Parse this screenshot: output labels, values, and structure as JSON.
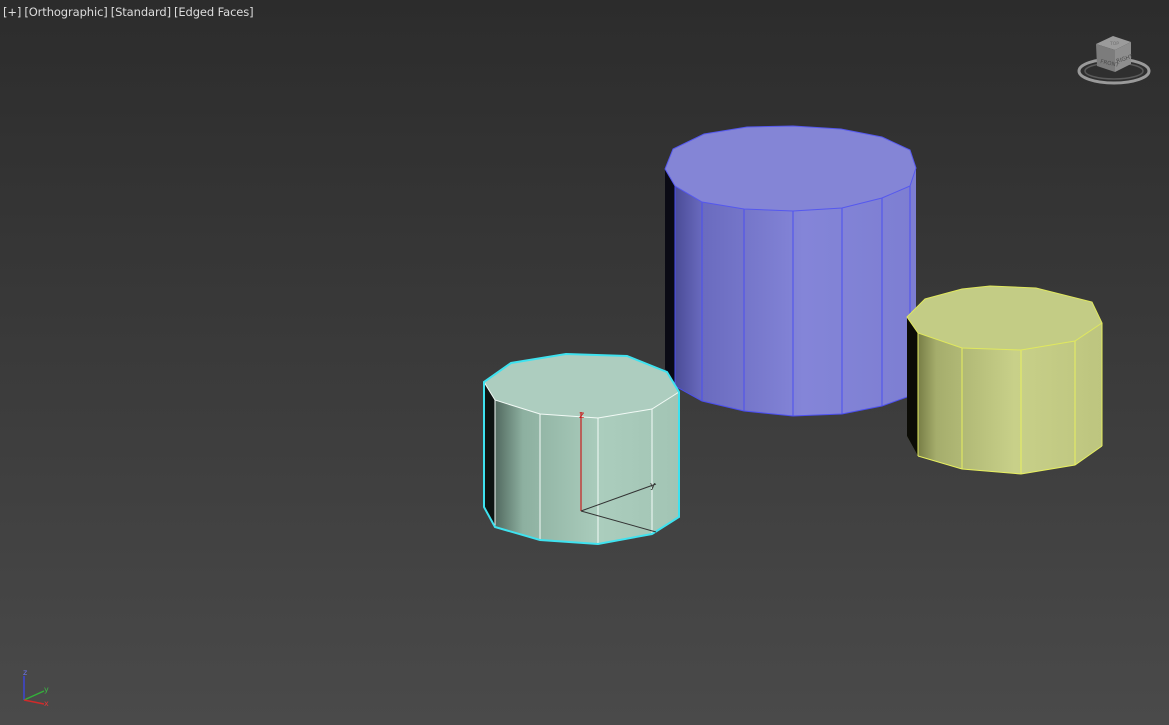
{
  "viewport": {
    "labels": {
      "menu": "[+]",
      "view": "[Orthographic]",
      "shading": "[Standard]",
      "edged": "[Edged Faces]"
    },
    "viewcube": {
      "icon": "viewcube-icon",
      "face_front": "FRONT",
      "face_right": "RIGHT",
      "face_top": "TOP"
    },
    "gizmo_axes": {
      "z": "z",
      "y": "y"
    },
    "corner_axes": {
      "z": "z",
      "y": "y",
      "x": "x"
    },
    "objects": [
      {
        "name": "cylinder-blue",
        "color": "#7f80d6",
        "selected": false
      },
      {
        "name": "cylinder-yellow",
        "color": "#c3cd84",
        "selected": false
      },
      {
        "name": "cylinder-mint",
        "color": "#a9cbbb",
        "selected": true,
        "selection_color": "#3fe2ef"
      }
    ]
  },
  "colors": {
    "background_top": "#2c2c2c",
    "background_bottom": "#4a4a4a",
    "selection_outline": "#3fe2ef"
  }
}
